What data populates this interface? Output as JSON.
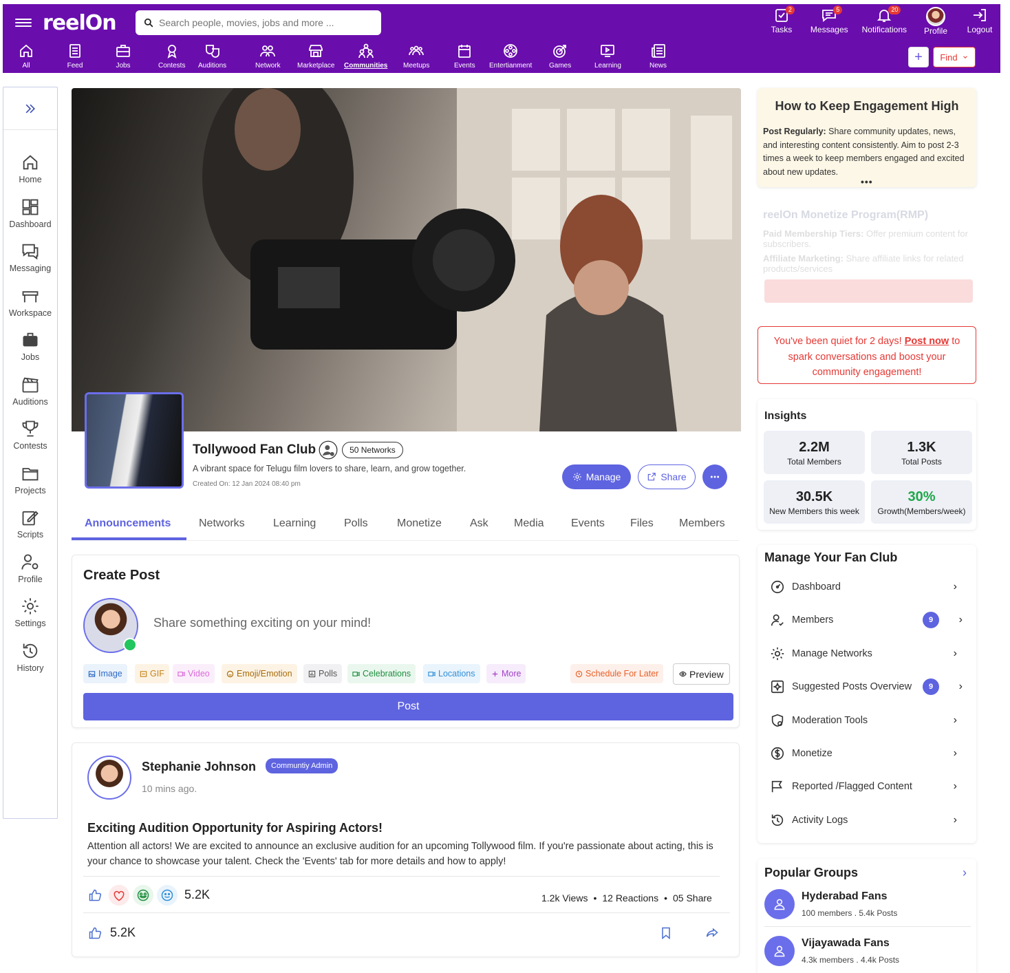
{
  "app": {
    "name": "reelOn"
  },
  "search": {
    "placeholder": "Search people, movies, jobs and more ..."
  },
  "top_actions": [
    {
      "label": "Tasks",
      "badge": "2",
      "icon": "tasks-icon"
    },
    {
      "label": "Messages",
      "badge": "5",
      "icon": "messages-icon"
    },
    {
      "label": "Notifications",
      "badge": "20",
      "icon": "bell-icon"
    },
    {
      "label": "Profile",
      "badge": "",
      "icon": "avatar"
    },
    {
      "label": "Logout",
      "badge": "",
      "icon": "logout-icon"
    }
  ],
  "nav": [
    {
      "label": "All",
      "icon": "home-icon",
      "active": false
    },
    {
      "label": "Feed",
      "icon": "feed-icon",
      "active": false
    },
    {
      "label": "Jobs",
      "icon": "jobs-icon",
      "active": false
    },
    {
      "label": "Contests",
      "icon": "award-icon",
      "active": false
    },
    {
      "label": "Auditions",
      "icon": "masks-icon",
      "active": false
    },
    {
      "label": "Network",
      "icon": "network-icon",
      "active": false
    },
    {
      "label": "Marketplace",
      "icon": "store-icon",
      "active": false
    },
    {
      "label": "Communities",
      "icon": "communities-icon",
      "active": true
    },
    {
      "label": "Meetups",
      "icon": "meetups-icon",
      "active": false
    },
    {
      "label": "Events",
      "icon": "calendar-icon",
      "active": false
    },
    {
      "label": "Entertianment",
      "icon": "film-reel-icon",
      "active": false
    },
    {
      "label": "Games",
      "icon": "target-icon",
      "active": false
    },
    {
      "label": "Learning",
      "icon": "play-screen-icon",
      "active": false
    },
    {
      "label": "News",
      "icon": "news-icon",
      "active": false
    }
  ],
  "find": {
    "label": "Find"
  },
  "plus": {
    "label": "+"
  },
  "sidebar": [
    {
      "label": "Home",
      "icon": "home-icon"
    },
    {
      "label": "Dashboard",
      "icon": "dashboard-icon"
    },
    {
      "label": "Messaging",
      "icon": "chat-icon"
    },
    {
      "label": "Workspace",
      "icon": "workspace-icon"
    },
    {
      "label": "Jobs",
      "icon": "briefcase-icon"
    },
    {
      "label": "Auditions",
      "icon": "clapperboard-icon"
    },
    {
      "label": "Contests",
      "icon": "trophy-icon"
    },
    {
      "label": "Projects",
      "icon": "folder-icon"
    },
    {
      "label": "Scripts",
      "icon": "pen-icon"
    },
    {
      "label": "Profile",
      "icon": "profile-settings-icon"
    },
    {
      "label": "Settings",
      "icon": "gear-icon"
    },
    {
      "label": "History",
      "icon": "history-icon"
    }
  ],
  "club": {
    "name": "Tollywood Fan Club",
    "networks": "50 Networks",
    "description": "A vibrant space for Telugu film lovers to share, learn, and grow together.",
    "created": "Created On: 12 Jan 2024 08:40 pm",
    "manage_label": "Manage",
    "share_label": "Share"
  },
  "tabs": [
    "Announcements",
    "Networks",
    "Learning",
    "Polls",
    "Monetize",
    "Ask",
    "Media",
    "Events",
    "Files",
    "Members"
  ],
  "create_post": {
    "title": "Create Post",
    "placeholder": "Share something exciting on your mind!",
    "chips": [
      {
        "label": "Image",
        "color": "#2e6bc6",
        "bg": "#eaf2fb"
      },
      {
        "label": "GIF",
        "color": "#c7821a",
        "bg": "#fdf3e4"
      },
      {
        "label": "Video",
        "color": "#d96ad9",
        "bg": "#fbeefb"
      },
      {
        "label": "Emoji/Emotion",
        "color": "#a66a0a",
        "bg": "#fdf3e4"
      },
      {
        "label": "Polls",
        "color": "#555555",
        "bg": "#f1f1f3"
      },
      {
        "label": "Celebrations",
        "color": "#1e8e3e",
        "bg": "#eaf7ee"
      },
      {
        "label": "Locations",
        "color": "#2f8fd9",
        "bg": "#eaf4fc"
      },
      {
        "label": "More",
        "color": "#a23fc7",
        "bg": "#f6ecfb"
      }
    ],
    "schedule": "Schedule For Later",
    "preview": "Preview",
    "post": "Post"
  },
  "post": {
    "author": "Stephanie Johnson",
    "role": "Communtiy Admin",
    "time": "10 mins ago.",
    "title": "Exciting Audition Opportunity for Aspiring Actors!",
    "body": "Attention all actors! We are excited to announce an exclusive audition for an upcoming Tollywood film. If you're passionate about acting, this is your chance to showcase your talent. Check the 'Events' tab for more details and how to apply!",
    "reactions_total": "5.2K",
    "views": "1.2k Views",
    "reactions": "12 Reactions",
    "shares": "05 Share",
    "likes": "5.2K"
  },
  "tip": {
    "title": "How to Keep Engagement High",
    "lead": "Post Regularly:",
    "text": " Share community updates, news, and interesting content consistently. Aim to post 2-3 times a week to keep members engaged and excited about new updates.",
    "more": "•••"
  },
  "monetize_promo": {
    "title": "reelOn Monetize Program(RMP)",
    "item1_lead": "Paid Membership Tiers:",
    "item1": " Offer premium content for subscribers.",
    "item2_lead": "Affiliate Marketing:",
    "item2": " Share affiliate links for related products/services"
  },
  "quiet": {
    "before": "You've been quiet for 2 days! ",
    "link": "Post now",
    "after": " to spark conversations and boost your community engagement!"
  },
  "insights": {
    "title": "Insights",
    "stats": [
      {
        "value": "2.2M",
        "label": "Total Members",
        "color": "#222222"
      },
      {
        "value": "1.3K",
        "label": "Total Posts",
        "color": "#222222"
      },
      {
        "value": "30.5K",
        "label": "New Members this week",
        "color": "#222222"
      },
      {
        "value": "30%",
        "label": "Growth(Members/week)",
        "color": "#1ea84a"
      }
    ]
  },
  "manage": {
    "title": "Manage Your Fan Club",
    "items": [
      {
        "label": "Dashboard",
        "count": ""
      },
      {
        "label": "Members",
        "count": "9"
      },
      {
        "label": "Manage Networks",
        "count": ""
      },
      {
        "label": "Suggested Posts Overview",
        "count": "9"
      },
      {
        "label": "Moderation Tools",
        "count": ""
      },
      {
        "label": "Monetize",
        "count": ""
      },
      {
        "label": "Reported /Flagged Content",
        "count": ""
      },
      {
        "label": "Activity Logs",
        "count": ""
      }
    ]
  },
  "popular": {
    "title": "Popular Groups",
    "groups": [
      {
        "name": "Hyderabad Fans",
        "meta": "100 members .  5.4k Posts"
      },
      {
        "name": "Vijayawada Fans",
        "meta": "4.3k members .  4.4k Posts"
      }
    ]
  },
  "colors": {
    "brand": "#6a0dad",
    "accent": "#5e63e0",
    "alert": "#e53935",
    "growth": "#1ea84a"
  }
}
